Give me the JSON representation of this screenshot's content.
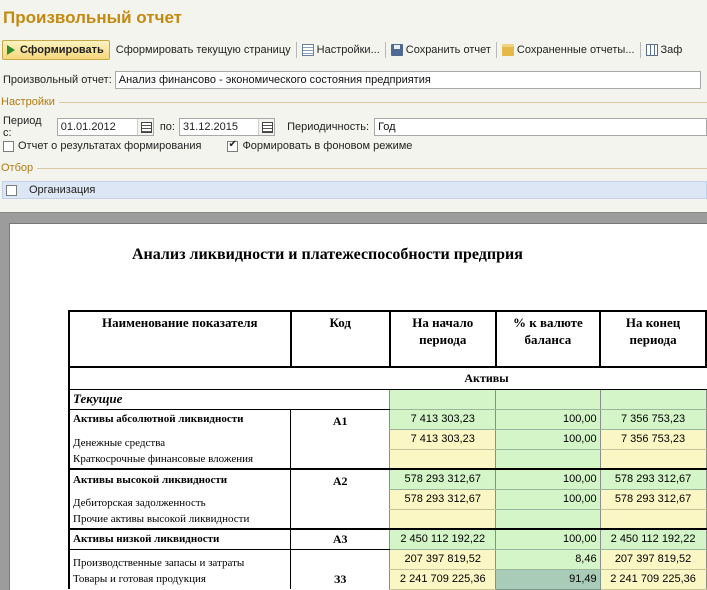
{
  "window": {
    "title": "Произвольный отчет"
  },
  "toolbar": {
    "generate": "Сформировать",
    "generate_page": "Сформировать текущую страницу",
    "settings": "Настройки...",
    "save": "Сохранить отчет",
    "saved": "Сохраненные отчеты...",
    "table": "Заф"
  },
  "form": {
    "report_label": "Произвольный отчет:",
    "report_value": "Анализ финансово - экономического состояния предприятия",
    "settings_section": "Настройки",
    "period_from_label": "Период с:",
    "period_from": "01.01.2012",
    "period_to_label": "по:",
    "period_to": "31.12.2015",
    "periodicity_label": "Периодичность:",
    "periodicity": "Год",
    "report_results_label": "Отчет о результатах формирования",
    "report_results_checked": false,
    "background_label": "Формировать в фоновом режиме",
    "background_checked": true,
    "filter_section": "Отбор",
    "filter_org": "Организация"
  },
  "report": {
    "title": "Анализ ликвидности и платежеспособности предприя",
    "headers": {
      "name": "Наименование показателя",
      "code": "Код",
      "start": "На начало периода",
      "pct": "% к валюте баланса",
      "end": "На конец периода"
    },
    "section_assets": "Активы",
    "group_current": "Текущие",
    "rows": {
      "a1_name": "Активы абсолютной ликвидности",
      "a1_code": "А1",
      "a1_start": "7 413 303,23",
      "a1_pct": "100,00",
      "a1_end": "7 356 753,23",
      "cash_name": "Денежные средства",
      "cash_start": "7 413 303,23",
      "cash_pct": "100,00",
      "cash_end": "7 356 753,23",
      "stfi_name": "Краткосрочные финансовые вложения",
      "a2_name": "Активы высокой ликвидности",
      "a2_code": "А2",
      "a2_start": "578 293 312,67",
      "a2_pct": "100,00",
      "a2_end": "578 293 312,67",
      "recv_name": "Дебиторская задолженность",
      "recv_start": "578 293 312,67",
      "recv_pct": "100,00",
      "recv_end": "578 293 312,67",
      "other_name": "Прочие активы высокой ликвидности",
      "a3_name": "Активы низкой ликвидности",
      "a3_code": "А3",
      "a3_start": "2 450 112 192,22",
      "a3_pct": "100,00",
      "a3_end": "2 450 112 192,22",
      "prod_name": "Производственные запасы и затраты",
      "prod_start": "207 397 819,52",
      "prod_pct": "8,46",
      "prod_end": "207 397 819,52",
      "goods_name": "Товары и готовая продукция",
      "goods_code": "З3",
      "goods_start": "2 241 709 225,36",
      "goods_pct": "91,49",
      "goods_end": "2 241 709 225,36"
    }
  },
  "colors": {
    "title_orange": "#c48a10",
    "cell_green": "#d4f5c8",
    "cell_yellow": "#fbf7c4",
    "cell_selected": "#a9ccb9",
    "filter_bg": "#dce6f4"
  }
}
